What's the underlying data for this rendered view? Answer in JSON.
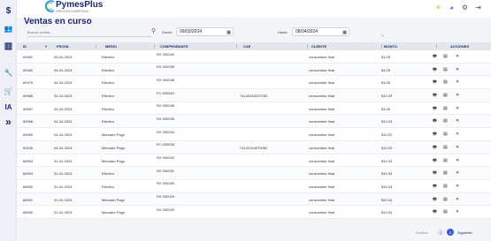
{
  "app": {
    "brand": "PymesPlus",
    "brand_sub": "GESTION COMERCIAL"
  },
  "sidebar": {
    "icons": [
      {
        "name": "dollar-icon",
        "glyph": "$"
      },
      {
        "name": "users-icon",
        "glyph": "👥"
      },
      {
        "name": "barcode-icon",
        "glyph": "▥"
      },
      {
        "name": "wrench-icon",
        "glyph": "🔧"
      },
      {
        "name": "cart-icon",
        "glyph": "🛒"
      },
      {
        "name": "ai-icon",
        "glyph": "IA"
      },
      {
        "name": "double-chevron-icon",
        "glyph": "»"
      }
    ]
  },
  "header": {
    "icons": [
      "sun-icon",
      "palette-icon",
      "settings-icon",
      "logout-icon"
    ]
  },
  "page": {
    "title": "Ventas en curso"
  },
  "filters": {
    "search_placeholder": "Buscar ventas...",
    "desde_label": "Desde",
    "desde_value": "09/03/2024",
    "hasta_label": "Hasta",
    "hasta_value": "08/04/2024"
  },
  "table": {
    "headers": {
      "id": "ID",
      "fecha": "FECHA",
      "medio": "MEDIO",
      "comprobante": "COMPROBANTE",
      "cae": "CAE",
      "cliente": "CLIENTE",
      "monto": "MONTO",
      "acciones": "ACCIONES"
    },
    "rows": [
      {
        "id": "69481",
        "fecha": "05-04-2024",
        "medio": "Efectivo",
        "comprobante": "RX 000040",
        "cae": "",
        "cliente": "consumidor final",
        "monto": "$1.05"
      },
      {
        "id": "69480",
        "fecha": "05-04-2024",
        "medio": "Efectivo",
        "comprobante": "RX 000039",
        "cae": "",
        "cliente": "consumidor final",
        "monto": "$1.05"
      },
      {
        "id": "69479",
        "fecha": "04-04-2024",
        "medio": "Efectivo",
        "comprobante": "RX 000038",
        "cae": "",
        "cliente": "consumidor final",
        "monto": "$1.05"
      },
      {
        "id": "69068",
        "fecha": "04-04-2024",
        "medio": "Efectivo",
        "comprobante": "FC 000040",
        "cae": "74140154070752",
        "cliente": "consumidor final",
        "monto": "$10.03"
      },
      {
        "id": "69067",
        "fecha": "04-04-2024",
        "medio": "Efectivo",
        "comprobante": "RX 000036",
        "cae": "",
        "cliente": "consumidor final",
        "monto": "$1.05"
      },
      {
        "id": "69066",
        "fecha": "04-04-2024",
        "medio": "Efectivo",
        "comprobante": "RX 000035",
        "cae": "",
        "cliente": "consumidor final",
        "monto": "$10.03"
      },
      {
        "id": "69065",
        "fecha": "04-04-2024",
        "medio": "Mercado Pago",
        "comprobante": "RX 000034",
        "cae": "",
        "cliente": "consumidor final",
        "monto": "$10.22"
      },
      {
        "id": "69106",
        "fecha": "04-04-2024",
        "medio": "Mercado Pago",
        "comprobante": "FC 000038",
        "cae": "74140154070052",
        "cliente": "consumidor final",
        "monto": "$10.03"
      },
      {
        "id": "68994",
        "fecha": "31-04-2024",
        "medio": "Mercado Pago",
        "comprobante": "RX 000032",
        "cae": "",
        "cliente": "consumidor final",
        "monto": "$10.34"
      },
      {
        "id": "68993",
        "fecha": "31-04-2024",
        "medio": "Efectivo",
        "comprobante": "RX 000031",
        "cae": "",
        "cliente": "consumidor final",
        "monto": "$10.34"
      },
      {
        "id": "68992",
        "fecha": "31-04-2024",
        "medio": "Efectivo",
        "comprobante": "RX 000030",
        "cae": "",
        "cliente": "consumidor final",
        "monto": "$10.03"
      },
      {
        "id": "68991",
        "fecha": "31-04-2024",
        "medio": "Mercado Pago",
        "comprobante": "RX 000029",
        "cae": "",
        "cliente": "consumidor final",
        "monto": "$20.34"
      },
      {
        "id": "68990",
        "fecha": "31-04-2024",
        "medio": "Mercado Pago",
        "comprobante": "RX 000025",
        "cae": "",
        "cliente": "consumidor final",
        "monto": "$10.03"
      }
    ]
  },
  "pagination": {
    "prev_label": "Anterior",
    "page1": "1",
    "page2": "2",
    "next_label": "Siguiente"
  },
  "colors": {
    "primary": "#1a2a6c",
    "accent": "#3b5bdb"
  }
}
